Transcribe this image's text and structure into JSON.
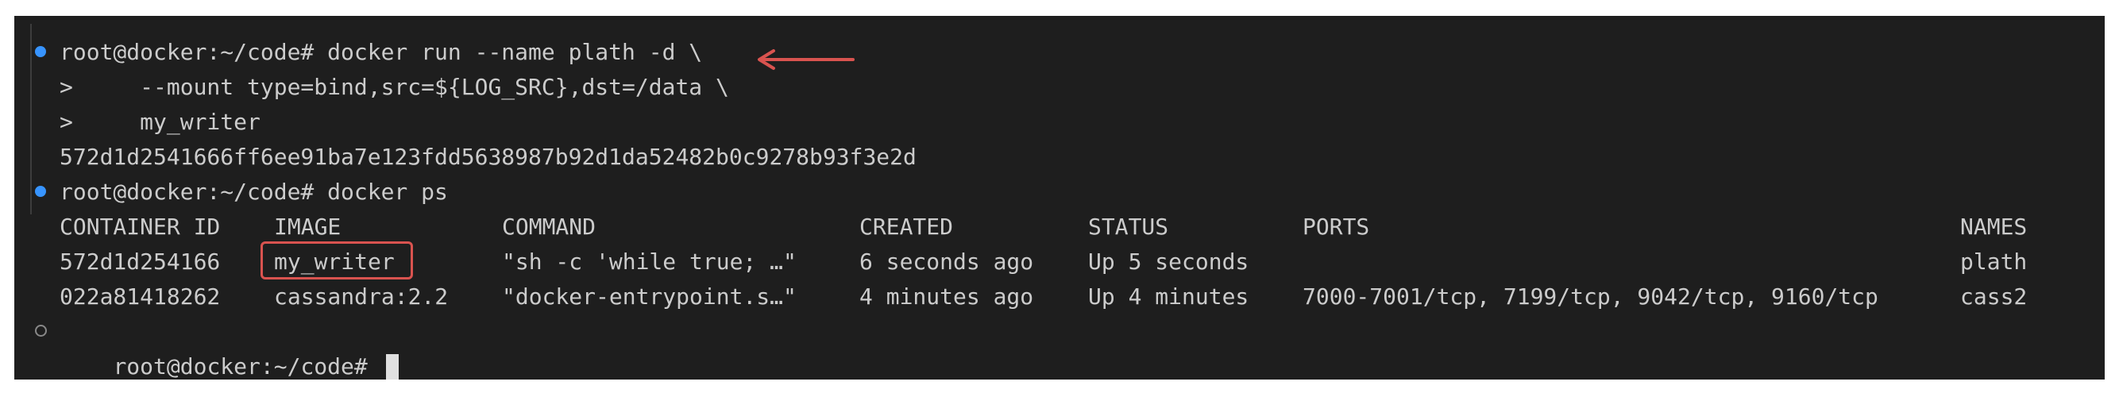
{
  "lines": {
    "cmd1": "root@docker:~/code# docker run --name plath -d \\",
    "cont1": ">     --mount type=bind,src=${LOG_SRC},dst=/data \\",
    "cont2": ">     my_writer",
    "hash": "572d1d2541666ff6ee91ba7e123fdd5638987b92d1da52482b0c9278b93f3e2d",
    "cmd2": "root@docker:~/code# docker ps",
    "prompt": "root@docker:~/code# "
  },
  "table": {
    "headers": [
      "CONTAINER ID",
      "IMAGE",
      "COMMAND",
      "CREATED",
      "STATUS",
      "PORTS",
      "NAMES"
    ],
    "rows": [
      [
        "572d1d254166",
        "my_writer",
        "\"sh -c 'while true; …\"",
        "6 seconds ago",
        "Up 5 seconds",
        "",
        "plath"
      ],
      [
        "022a81418262",
        "cassandra:2.2",
        "\"docker-entrypoint.s…\"",
        "4 minutes ago",
        "Up 4 minutes",
        "7000-7001/tcp, 7199/tcp, 9042/tcp, 9160/tcp",
        "cass2"
      ]
    ]
  },
  "colors": {
    "background": "#1e1e1e",
    "text": "#cccccc",
    "marker_active": "#3794ff",
    "annotation": "#d9534f"
  },
  "icons": {
    "marker_active": "circle-filled",
    "marker_idle": "circle-outline",
    "annotation_arrow": "arrow-left"
  }
}
